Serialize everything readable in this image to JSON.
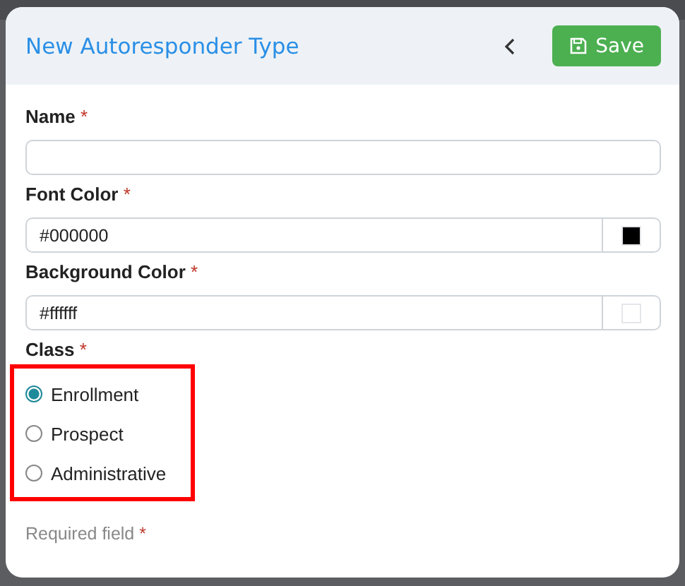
{
  "dialog": {
    "title": "New Autoresponder Type",
    "save_button": "Save",
    "fields": [
      {
        "kind": "text",
        "label": "Name",
        "required_mark": "*"
      },
      {
        "kind": "color",
        "label": "Font Color",
        "required_mark": "*",
        "value": "#000000",
        "color": "#000000"
      },
      {
        "kind": "color",
        "label": "Background Color",
        "required_mark": "*",
        "value": "#ffffff",
        "color": "#ffffff"
      }
    ],
    "class_group": {
      "label": "Class",
      "required_mark": "*",
      "highlighted": true,
      "options": [
        {
          "label": "Enrollment",
          "selected": true
        },
        {
          "label": "Prospect",
          "selected": false
        },
        {
          "label": "Administrative",
          "selected": false
        }
      ]
    },
    "footnote": {
      "text": "Required field",
      "mark": "*"
    }
  }
}
